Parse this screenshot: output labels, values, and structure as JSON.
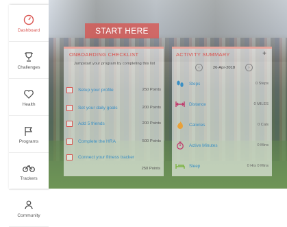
{
  "sidebar": {
    "items": [
      {
        "label": "Dashboard",
        "icon": "dashboard-gauge-icon",
        "active": true
      },
      {
        "label": "Challenges",
        "icon": "trophy-icon"
      },
      {
        "label": "Health",
        "icon": "heart-icon"
      },
      {
        "label": "Programs",
        "icon": "flag-icon"
      },
      {
        "label": "Trackers",
        "icon": "bicycle-icon"
      },
      {
        "label": "Community",
        "icon": "people-icon"
      }
    ]
  },
  "hero": {
    "cta_label": "START HERE"
  },
  "onboarding": {
    "title": "ONBOARDING CHECKLIST",
    "subtitle": "Jumpstart your program by completing this list",
    "tasks": [
      {
        "label": "Setup your profile",
        "points": "250 Points"
      },
      {
        "label": "Set your daily goals",
        "points": "200 Points"
      },
      {
        "label": "Add 5 friends",
        "points": "200 Points"
      },
      {
        "label": "Complete the HRA",
        "points": "500 Points"
      },
      {
        "label": "Connect your fitness tracker",
        "points": "250 Points"
      }
    ],
    "total": "250 Points"
  },
  "activity": {
    "title": "ACTIVITY SUMMARY",
    "add_label": "+",
    "date": "26-Apr-2018",
    "prev_label": "‹",
    "next_label": "›",
    "metrics": [
      {
        "label": "Steps",
        "value": "0 Steps",
        "icon": "footsteps-icon",
        "color": "#3a8fc4"
      },
      {
        "label": "Distance",
        "value": "0 MILES",
        "icon": "distance-arrows-icon",
        "color": "#c0396b"
      },
      {
        "label": "Calories",
        "value": "0 Cals",
        "icon": "flame-icon",
        "color": "#e8a13a"
      },
      {
        "label": "Active Minutes",
        "value": "0 Mins",
        "icon": "stopwatch-icon",
        "color": "#c0396b"
      },
      {
        "label": "Sleep",
        "value": "0 Hrs 0 Mins",
        "icon": "bed-icon",
        "color": "#7cb342"
      }
    ]
  },
  "colors": {
    "accent": "#d9534f",
    "link": "#3a8fc4"
  }
}
